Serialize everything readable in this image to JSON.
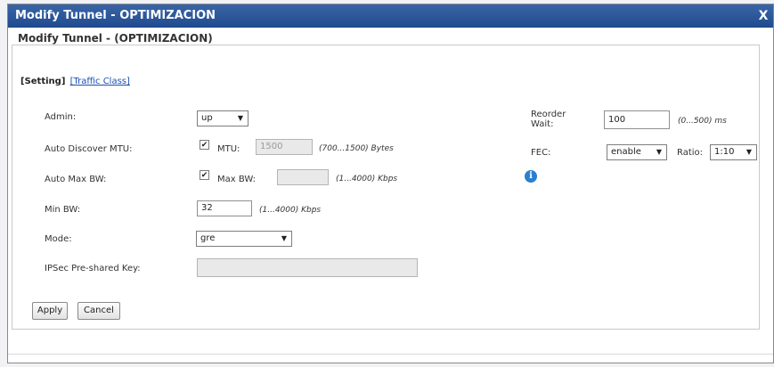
{
  "dialog": {
    "title": "Modify Tunnel - OPTIMIZACION",
    "close_label": "X",
    "section_title": "Modify Tunnel - (OPTIMIZACION)"
  },
  "tabs": [
    {
      "label": "[Setting]"
    },
    {
      "label": "[Traffic Class]"
    }
  ],
  "form": {
    "admin": {
      "label": "Admin:",
      "value": "up"
    },
    "auto_discover_mtu": {
      "label": "Auto Discover MTU:",
      "checked": "✔",
      "mtu_label": "MTU:",
      "mtu_value": "1500",
      "mtu_unit": "(700...1500) Bytes"
    },
    "auto_max_bw": {
      "label": "Auto Max BW:",
      "checked": "✔",
      "max_bw_label": "Max BW:",
      "max_bw_value": "",
      "max_bw_unit": "(1...4000) Kbps"
    },
    "min_bw": {
      "label": "Min BW:",
      "value": "32",
      "unit": "(1...4000) Kbps"
    },
    "mode": {
      "label": "Mode:",
      "value": "gre"
    },
    "ipsec_key": {
      "label": "IPSec Pre-shared Key:",
      "value": ""
    },
    "reorder_wait": {
      "label_line1": "Reorder",
      "label_line2": "Wait:",
      "value": "100",
      "unit": "(0...500) ms"
    },
    "fec": {
      "label": "FEC:",
      "value": "enable",
      "ratio_label": "Ratio:",
      "ratio_value": "1:10"
    },
    "info_icon": "i"
  },
  "buttons": {
    "apply": "Apply",
    "cancel": "Cancel"
  },
  "colors": {
    "titlebar": "#1f4a8e",
    "link": "#1a4fb0",
    "info_icon": "#2a7fd0"
  }
}
